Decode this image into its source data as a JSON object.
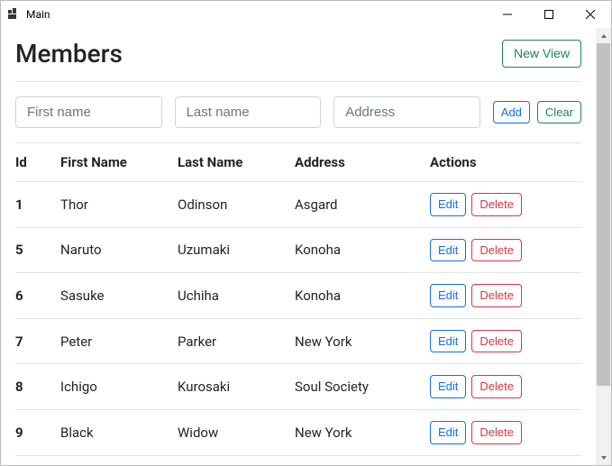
{
  "window": {
    "title": "Main"
  },
  "header": {
    "title": "Members",
    "new_view_label": "New View"
  },
  "form": {
    "first_name_placeholder": "First name",
    "last_name_placeholder": "Last name",
    "address_placeholder": "Address",
    "add_label": "Add",
    "clear_label": "Clear"
  },
  "table": {
    "headers": {
      "id": "Id",
      "first_name": "First Name",
      "last_name": "Last Name",
      "address": "Address",
      "actions": "Actions"
    },
    "action_labels": {
      "edit": "Edit",
      "delete": "Delete"
    },
    "rows": [
      {
        "id": "1",
        "first_name": "Thor",
        "last_name": "Odinson",
        "address": "Asgard"
      },
      {
        "id": "5",
        "first_name": "Naruto",
        "last_name": "Uzumaki",
        "address": "Konoha"
      },
      {
        "id": "6",
        "first_name": "Sasuke",
        "last_name": "Uchiha",
        "address": "Konoha"
      },
      {
        "id": "7",
        "first_name": "Peter",
        "last_name": "Parker",
        "address": "New York"
      },
      {
        "id": "8",
        "first_name": "Ichigo",
        "last_name": "Kurosaki",
        "address": "Soul Society"
      },
      {
        "id": "9",
        "first_name": "Black",
        "last_name": "Widow",
        "address": "New York"
      }
    ]
  }
}
